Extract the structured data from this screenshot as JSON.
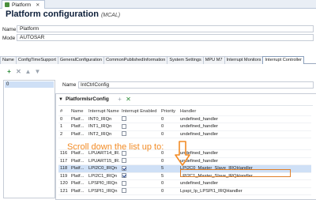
{
  "editor_tab": {
    "label": "Platform"
  },
  "header": {
    "title": "Platform configuration",
    "subtitle": "(MCAL)"
  },
  "fields": {
    "name_label": "Name",
    "name_value": "Platform",
    "mode_label": "Mode",
    "mode_value": "AUTOSAR"
  },
  "config_tabs": [
    "Name",
    "ConfigTimeSupport",
    "GeneralConfiguration",
    "CommonPublishedInformation",
    "System Settings",
    "MPU M7",
    "Interrupt Monitors",
    "Interrupt Controller"
  ],
  "active_tab": "Interrupt Controller",
  "left_list": {
    "items": [
      "0"
    ]
  },
  "detail": {
    "name_label": "Name",
    "name_value": "IntCtrlConfig"
  },
  "section": {
    "title": "PlatformIsrConfig"
  },
  "table": {
    "headers": [
      "#",
      "Name",
      "Interrupt Name",
      "Interrupt Enabled",
      "Priority",
      "Handler"
    ],
    "rows": [
      {
        "idx": "0",
        "name": "Platf...",
        "irq": "INT0_IRQn",
        "enabled": false,
        "prio": "0",
        "handler": "undefined_handler"
      },
      {
        "idx": "1",
        "name": "Platf...",
        "irq": "INT1_IRQn",
        "enabled": false,
        "prio": "0",
        "handler": "undefined_handler"
      },
      {
        "idx": "2",
        "name": "Platf...",
        "irq": "INT2_IRQn",
        "enabled": false,
        "prio": "0",
        "handler": "undefined_handler"
      }
    ],
    "rows_bottom": [
      {
        "idx": "116",
        "name": "Platf...",
        "irq": "LPUART14_IR...",
        "enabled": false,
        "prio": "0",
        "handler": "undefined_handler"
      },
      {
        "idx": "117",
        "name": "Platf...",
        "irq": "LPUART15_IR...",
        "enabled": false,
        "prio": "0",
        "handler": "undefined_handler"
      },
      {
        "idx": "118",
        "name": "Platf...",
        "irq": "LPI2C0_IRQn",
        "enabled": true,
        "prio": "5",
        "handler": "LPI2C0_Master_Slave_IRQHandler"
      },
      {
        "idx": "119",
        "name": "Platf...",
        "irq": "LPI2C1_IRQn",
        "enabled": true,
        "prio": "5",
        "handler": "LPI2C1_Master_Slave_IRQHandler"
      },
      {
        "idx": "120",
        "name": "Platf...",
        "irq": "LPSPI0_IRQn",
        "enabled": false,
        "prio": "0",
        "handler": "undefined_handler"
      },
      {
        "idx": "121",
        "name": "Platf...",
        "irq": "LPSPI1_IRQn",
        "enabled": false,
        "prio": "0",
        "handler": "Lpspi_Ip_LPSPI1_IRQHandler"
      }
    ]
  },
  "annotation": {
    "text": "Scroll down the list up to:"
  },
  "colors": {
    "accent": "#f28b25",
    "selection": "#cfe0f6",
    "active_tab_border": "#8aa0bd"
  }
}
